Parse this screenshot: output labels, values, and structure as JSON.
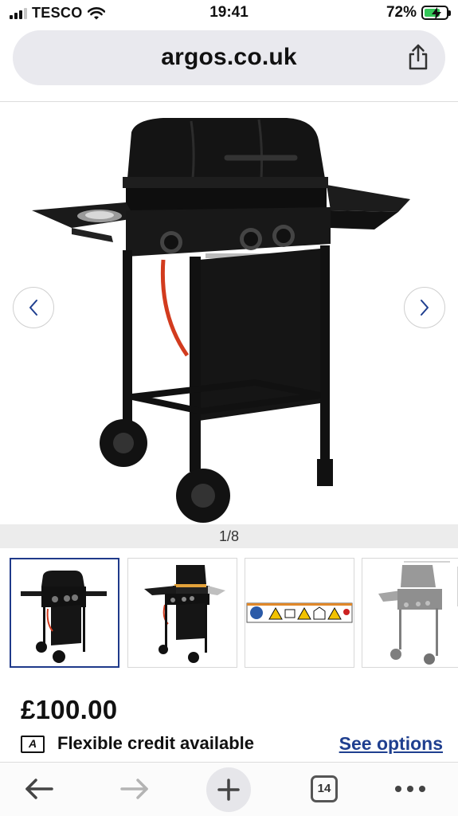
{
  "status_bar": {
    "carrier": "TESCO",
    "time": "19:41",
    "battery_percent": "72%",
    "battery_level": 0.72
  },
  "browser": {
    "url": "argos.co.uk",
    "share_icon": "share-icon"
  },
  "gallery": {
    "counter": "1/8",
    "prev_icon": "chevron-left-icon",
    "next_icon": "chevron-right-icon",
    "thumbnails": [
      {
        "label": "bbq-front-view",
        "selected": true
      },
      {
        "label": "bbq-open-lid-view",
        "selected": false
      },
      {
        "label": "safety-symbols",
        "selected": false
      },
      {
        "label": "bbq-dimensions-diagram",
        "selected": false
      }
    ]
  },
  "product": {
    "price": "£100.00",
    "credit_icon_letter": "A",
    "credit_text": "Flexible credit available",
    "see_options": "See options"
  },
  "toolbar": {
    "tabs_count": "14",
    "icons": [
      "back-arrow-icon",
      "forward-arrow-icon",
      "new-tab-plus-icon",
      "tabs-icon",
      "more-icon"
    ]
  },
  "colors": {
    "link": "#1f3f8f",
    "selected_thumb_border": "#1f3a8a",
    "battery": "#34c759",
    "url_bar_bg": "#e9e9ee"
  }
}
